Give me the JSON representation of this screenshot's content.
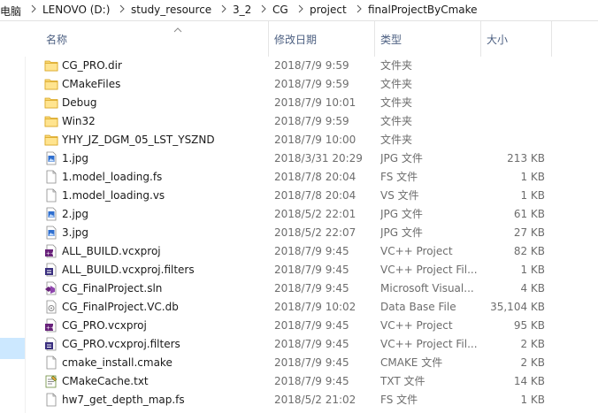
{
  "breadcrumb": [
    "电脑",
    "LENOVO (D:)",
    "study_resource",
    "3_2",
    "CG",
    "project",
    "finalProjectByCmake"
  ],
  "columns": {
    "name": "名称",
    "date": "修改日期",
    "type": "类型",
    "size": "大小"
  },
  "files": [
    {
      "name": "CG_PRO.dir",
      "date": "2018/7/9 9:59",
      "type": "文件夹",
      "size": "",
      "icon": "folder-icon"
    },
    {
      "name": "CMakeFiles",
      "date": "2018/7/9 9:59",
      "type": "文件夹",
      "size": "",
      "icon": "folder-icon"
    },
    {
      "name": "Debug",
      "date": "2018/7/9 10:01",
      "type": "文件夹",
      "size": "",
      "icon": "folder-icon"
    },
    {
      "name": "Win32",
      "date": "2018/7/9 9:59",
      "type": "文件夹",
      "size": "",
      "icon": "folder-icon"
    },
    {
      "name": "YHY_JZ_DGM_05_LST_YSZND",
      "date": "2018/7/9 10:00",
      "type": "文件夹",
      "size": "",
      "icon": "folder-icon"
    },
    {
      "name": "1.jpg",
      "date": "2018/3/31 20:29",
      "type": "JPG 文件",
      "size": "213 KB",
      "icon": "image-file-icon"
    },
    {
      "name": "1.model_loading.fs",
      "date": "2018/7/8 20:04",
      "type": "FS 文件",
      "size": "1 KB",
      "icon": "blank-file-icon"
    },
    {
      "name": "1.model_loading.vs",
      "date": "2018/7/8 20:04",
      "type": "VS 文件",
      "size": "1 KB",
      "icon": "blank-file-icon"
    },
    {
      "name": "2.jpg",
      "date": "2018/5/2 22:01",
      "type": "JPG 文件",
      "size": "61 KB",
      "icon": "image-file-icon"
    },
    {
      "name": "3.jpg",
      "date": "2018/5/2 22:07",
      "type": "JPG 文件",
      "size": "27 KB",
      "icon": "image-file-icon"
    },
    {
      "name": "ALL_BUILD.vcxproj",
      "date": "2018/7/9 9:45",
      "type": "VC++ Project",
      "size": "82 KB",
      "icon": "vcxproj-icon"
    },
    {
      "name": "ALL_BUILD.vcxproj.filters",
      "date": "2018/7/9 9:45",
      "type": "VC++ Project Fil...",
      "size": "1 KB",
      "icon": "vcxproj-filters-icon"
    },
    {
      "name": "CG_FinalProject.sln",
      "date": "2018/7/9 9:45",
      "type": "Microsoft Visual...",
      "size": "4 KB",
      "icon": "solution-icon"
    },
    {
      "name": "CG_FinalProject.VC.db",
      "date": "2018/7/9 10:02",
      "type": "Data Base File",
      "size": "35,104 KB",
      "icon": "database-file-icon"
    },
    {
      "name": "CG_PRO.vcxproj",
      "date": "2018/7/9 9:45",
      "type": "VC++ Project",
      "size": "95 KB",
      "icon": "vcxproj-icon"
    },
    {
      "name": "CG_PRO.vcxproj.filters",
      "date": "2018/7/9 9:45",
      "type": "VC++ Project Fil...",
      "size": "2 KB",
      "icon": "vcxproj-filters-icon"
    },
    {
      "name": "cmake_install.cmake",
      "date": "2018/7/9 9:45",
      "type": "CMAKE 文件",
      "size": "2 KB",
      "icon": "blank-file-icon"
    },
    {
      "name": "CMakeCache.txt",
      "date": "2018/7/9 9:45",
      "type": "TXT 文件",
      "size": "14 KB",
      "icon": "text-file-icon"
    },
    {
      "name": "hw7_get_depth_map.fs",
      "date": "2018/5/2 21:02",
      "type": "FS 文件",
      "size": "1 KB",
      "icon": "blank-file-icon"
    }
  ]
}
